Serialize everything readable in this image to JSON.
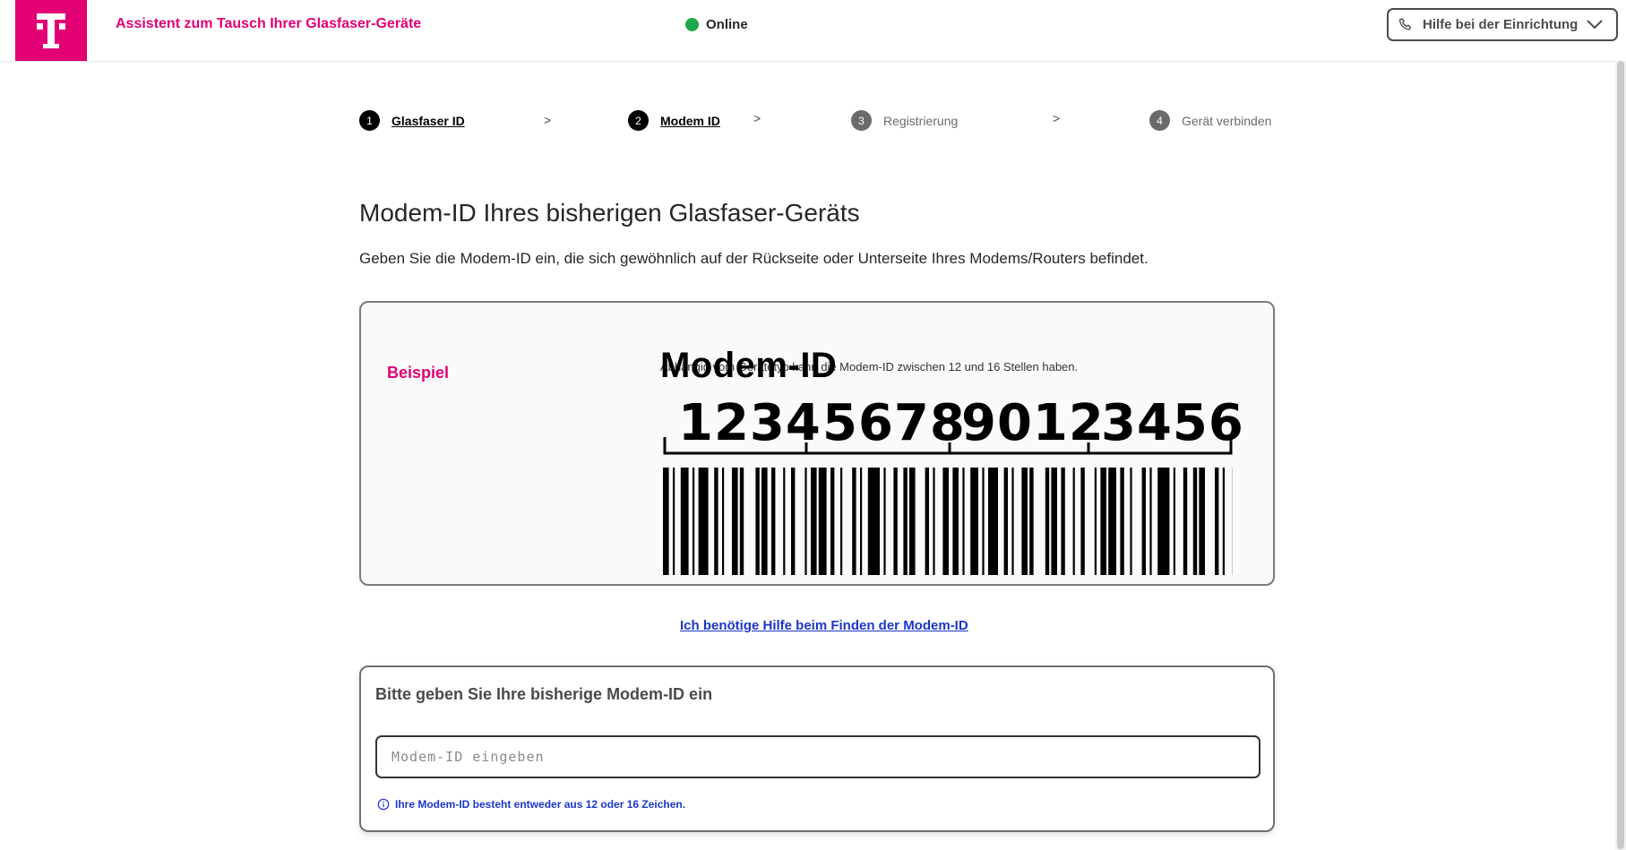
{
  "header": {
    "app_title": "Assistent zum Tausch Ihrer Glasfaser-Geräte",
    "status": "Online",
    "help_button": "Hilfe bei der Einrichtung"
  },
  "steps": [
    {
      "num": "1",
      "label": "Glasfaser ID",
      "state": "done"
    },
    {
      "num": "2",
      "label": "Modem ID",
      "state": "active"
    },
    {
      "num": "3",
      "label": "Registrierung",
      "state": "todo"
    },
    {
      "num": "4",
      "label": "Gerät verbinden",
      "state": "todo"
    }
  ],
  "separator": ">",
  "page": {
    "title": "Modem-ID Ihres bisherigen Glasfaser-Geräts",
    "description": "Geben Sie die Modem-ID ein, die sich gewöhnlich auf der Rückseite oder Unterseite Ihres Modems/Routers befindet."
  },
  "example": {
    "label": "Beispiel",
    "info": "Abhängig vom Gerätetyp kann die Modem-ID zwischen 12 und 16 Stellen haben.",
    "modem_label": "Modem-ID",
    "groups": [
      "1234",
      "5678",
      "9012",
      "3456"
    ]
  },
  "help_link": "Ich benötige Hilfe beim Finden der Modem-ID",
  "form": {
    "title": "Bitte geben Sie Ihre bisherige Modem-ID ein",
    "placeholder": "Modem-ID eingeben",
    "value": "",
    "hint": "Ihre Modem-ID besteht entweder aus 12 oder 16 Zeichen."
  },
  "colors": {
    "brand": "#e20074",
    "link": "#1b37c9",
    "online": "#1ea64a"
  },
  "icons": {
    "logo": "telekom-t-logo",
    "phone": "phone-icon",
    "chevron": "chevron-down-icon",
    "info": "info-icon"
  }
}
